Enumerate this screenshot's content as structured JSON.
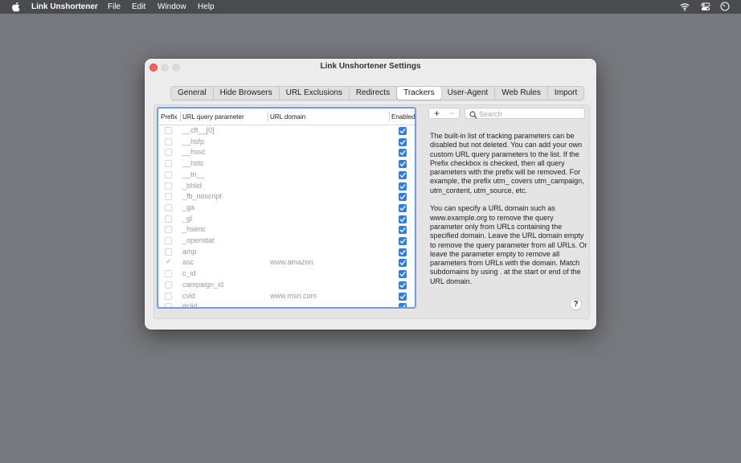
{
  "menubar": {
    "app_name": "Link Unshortener",
    "items": [
      "File",
      "Edit",
      "Window",
      "Help"
    ],
    "tray_icons": [
      "wifi-icon",
      "control-center-icon",
      "clock-icon"
    ]
  },
  "window": {
    "title": "Link Unshortener Settings",
    "tabs": [
      {
        "label": "General"
      },
      {
        "label": "Hide Browsers"
      },
      {
        "label": "URL Exclusions"
      },
      {
        "label": "Redirects"
      },
      {
        "label": "Trackers",
        "active": true
      },
      {
        "label": "User-Agent"
      },
      {
        "label": "Web Rules"
      },
      {
        "label": "Import"
      }
    ]
  },
  "trackers": {
    "columns": {
      "prefix": "Prefix",
      "parameter": "URL query parameter",
      "domain": "URL domain",
      "enabled": "Enabled"
    },
    "rows": [
      {
        "prefix": false,
        "parameter": "__cft__[0]",
        "domain": "",
        "enabled": true
      },
      {
        "prefix": false,
        "parameter": "__hsfp",
        "domain": "",
        "enabled": true
      },
      {
        "prefix": false,
        "parameter": "__hssc",
        "domain": "",
        "enabled": true
      },
      {
        "prefix": false,
        "parameter": "__hstc",
        "domain": "",
        "enabled": true
      },
      {
        "prefix": false,
        "parameter": "__tn__",
        "domain": "",
        "enabled": true
      },
      {
        "prefix": false,
        "parameter": "_bhlid",
        "domain": "",
        "enabled": true
      },
      {
        "prefix": false,
        "parameter": "_fb_noscript",
        "domain": "",
        "enabled": true
      },
      {
        "prefix": false,
        "parameter": "_ga",
        "domain": "",
        "enabled": true
      },
      {
        "prefix": false,
        "parameter": "_gl",
        "domain": "",
        "enabled": true
      },
      {
        "prefix": false,
        "parameter": "_hsenc",
        "domain": "",
        "enabled": true
      },
      {
        "prefix": false,
        "parameter": "_openstat",
        "domain": "",
        "enabled": true
      },
      {
        "prefix": false,
        "parameter": "amp",
        "domain": "",
        "enabled": true
      },
      {
        "prefix": true,
        "parameter": "asc",
        "domain": "www.amazon.",
        "enabled": true
      },
      {
        "prefix": false,
        "parameter": "c_id",
        "domain": "",
        "enabled": true
      },
      {
        "prefix": false,
        "parameter": "campaign_id",
        "domain": "",
        "enabled": true
      },
      {
        "prefix": false,
        "parameter": "cvid",
        "domain": "www.msn.com",
        "enabled": true
      },
      {
        "prefix": false,
        "parameter": "dclid",
        "domain": "",
        "enabled": true
      }
    ],
    "add_label": "+",
    "remove_label": "−",
    "search_placeholder": "Search",
    "search_value": "",
    "help_paragraph_1": "The built-in list of tracking parameters can be disabled but not deleted. You can add your own custom URL query parameters to the list. If the Prefix checkbox is checked, then all query parameters with the prefix will be removed. For example, the prefix utm_ covers utm_campaign, utm_content, utm_source, etc.",
    "help_paragraph_2": "You can specify a URL domain such as www.example.org to remove the query parameter only from URLs containing the specified domain. Leave the URL domain empty to remove the query parameter from all URLs. Or leave the parameter empty to remove all parameters from URLs with the domain. Match subdomains by using . at the start or end of the URL domain.",
    "help_button_label": "?"
  },
  "colors": {
    "accent": "#2e7de0",
    "focus_ring": "#6ea0e8",
    "close_button": "#ff5f57"
  }
}
